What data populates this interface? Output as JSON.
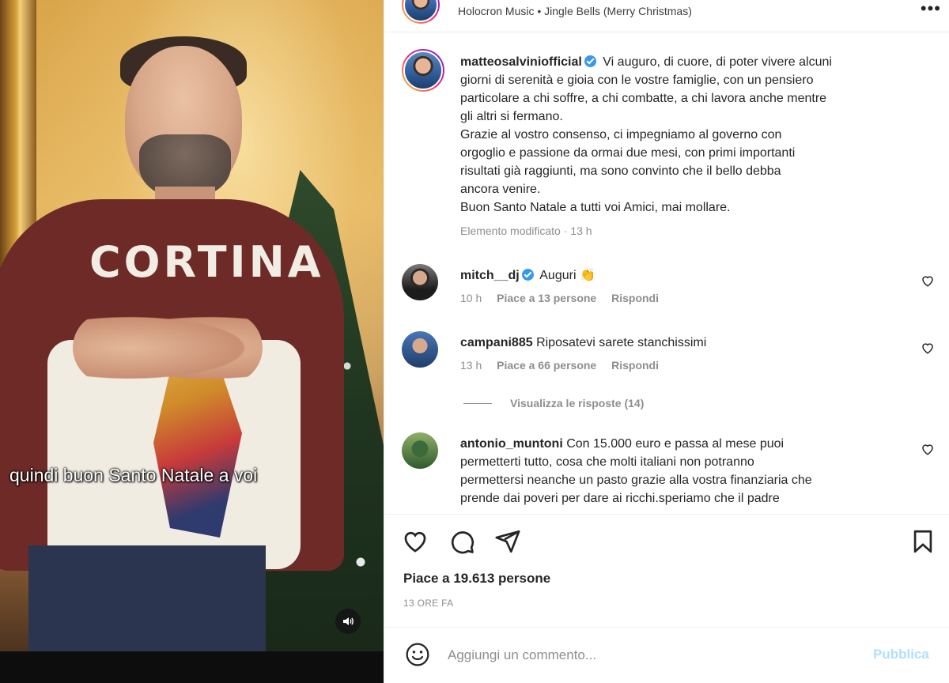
{
  "video": {
    "subtitle": "quindi buon Santo Natale a voi",
    "sweater_text": "CORTINA",
    "sound_icon": "speaker-icon"
  },
  "header": {
    "track": "Holocron Music • Jingle Bells (Merry Christmas)",
    "more_icon": "more-options-icon"
  },
  "caption": {
    "username": "matteosalviniofficial",
    "verified": true,
    "text_lines": [
      "Vi auguro, di cuore, di poter vivere alcuni",
      "giorni di serenità e gioia con le vostre famiglie, con un pensiero",
      "particolare a chi soffre, a chi combatte, a chi lavora anche mentre",
      "gli altri si fermano.",
      "Grazie al vostro consenso, ci impegniamo al governo con",
      "orgoglio e passione da ormai due mesi, con primi importanti",
      "risultati già raggiunti, ma sono convinto che il bello debba",
      "ancora venire.",
      "Buon Santo Natale a tutti voi Amici, mai mollare."
    ],
    "meta": "Elemento modificato · 13 h"
  },
  "comments": [
    {
      "username": "mitch__dj",
      "verified": true,
      "text": "Auguri 👏",
      "time": "10 h",
      "likes": "Piace a 13 persone",
      "reply": "Rispondi"
    },
    {
      "username": "campani885",
      "verified": false,
      "text": "Riposatevi sarete stanchissimi",
      "time": "13 h",
      "likes": "Piace a 66 persone",
      "reply": "Rispondi"
    },
    {
      "username": "antonio_muntoni",
      "verified": false,
      "text_lines": [
        "Con 15.000 euro e passa al mese puoi",
        "permetterti tutto, cosa che molti italiani non potranno",
        "permettersi neanche un pasto grazie alla vostra finanziaria che",
        "prende dai poveri per dare ai ricchi.speriamo che il padre"
      ]
    }
  ],
  "view_replies": "Visualizza le risposte (14)",
  "actions": {
    "like_icon": "heart-icon",
    "comment_icon": "comment-icon",
    "share_icon": "share-icon",
    "save_icon": "bookmark-icon"
  },
  "likes_text": "Piace a 19.613 persone",
  "time_ago": "13 ORE FA",
  "add_comment": {
    "placeholder": "Aggiungi un commento...",
    "publish_label": "Pubblica"
  },
  "colors": {
    "verified": "#3897f0",
    "secondary_text": "#8e8e8e",
    "publish_disabled": "#b2dffc"
  }
}
